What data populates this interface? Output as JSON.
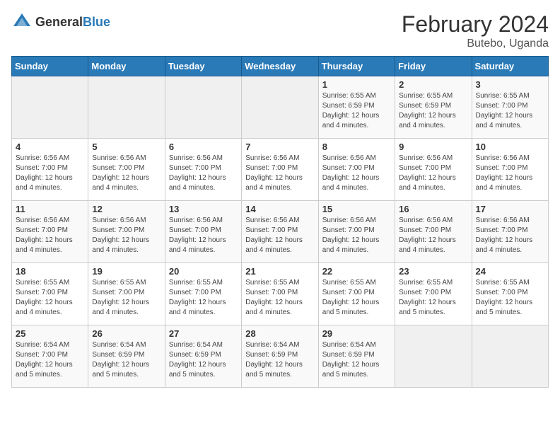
{
  "header": {
    "logo_general": "General",
    "logo_blue": "Blue",
    "month": "February 2024",
    "location": "Butebo, Uganda"
  },
  "days_of_week": [
    "Sunday",
    "Monday",
    "Tuesday",
    "Wednesday",
    "Thursday",
    "Friday",
    "Saturday"
  ],
  "weeks": [
    [
      {
        "day": "",
        "info": "",
        "empty": true
      },
      {
        "day": "",
        "info": "",
        "empty": true
      },
      {
        "day": "",
        "info": "",
        "empty": true
      },
      {
        "day": "",
        "info": "",
        "empty": true
      },
      {
        "day": "1",
        "info": "Sunrise: 6:55 AM\nSunset: 6:59 PM\nDaylight: 12 hours\nand 4 minutes.",
        "empty": false
      },
      {
        "day": "2",
        "info": "Sunrise: 6:55 AM\nSunset: 6:59 PM\nDaylight: 12 hours\nand 4 minutes.",
        "empty": false
      },
      {
        "day": "3",
        "info": "Sunrise: 6:55 AM\nSunset: 7:00 PM\nDaylight: 12 hours\nand 4 minutes.",
        "empty": false
      }
    ],
    [
      {
        "day": "4",
        "info": "Sunrise: 6:56 AM\nSunset: 7:00 PM\nDaylight: 12 hours\nand 4 minutes.",
        "empty": false
      },
      {
        "day": "5",
        "info": "Sunrise: 6:56 AM\nSunset: 7:00 PM\nDaylight: 12 hours\nand 4 minutes.",
        "empty": false
      },
      {
        "day": "6",
        "info": "Sunrise: 6:56 AM\nSunset: 7:00 PM\nDaylight: 12 hours\nand 4 minutes.",
        "empty": false
      },
      {
        "day": "7",
        "info": "Sunrise: 6:56 AM\nSunset: 7:00 PM\nDaylight: 12 hours\nand 4 minutes.",
        "empty": false
      },
      {
        "day": "8",
        "info": "Sunrise: 6:56 AM\nSunset: 7:00 PM\nDaylight: 12 hours\nand 4 minutes.",
        "empty": false
      },
      {
        "day": "9",
        "info": "Sunrise: 6:56 AM\nSunset: 7:00 PM\nDaylight: 12 hours\nand 4 minutes.",
        "empty": false
      },
      {
        "day": "10",
        "info": "Sunrise: 6:56 AM\nSunset: 7:00 PM\nDaylight: 12 hours\nand 4 minutes.",
        "empty": false
      }
    ],
    [
      {
        "day": "11",
        "info": "Sunrise: 6:56 AM\nSunset: 7:00 PM\nDaylight: 12 hours\nand 4 minutes.",
        "empty": false
      },
      {
        "day": "12",
        "info": "Sunrise: 6:56 AM\nSunset: 7:00 PM\nDaylight: 12 hours\nand 4 minutes.",
        "empty": false
      },
      {
        "day": "13",
        "info": "Sunrise: 6:56 AM\nSunset: 7:00 PM\nDaylight: 12 hours\nand 4 minutes.",
        "empty": false
      },
      {
        "day": "14",
        "info": "Sunrise: 6:56 AM\nSunset: 7:00 PM\nDaylight: 12 hours\nand 4 minutes.",
        "empty": false
      },
      {
        "day": "15",
        "info": "Sunrise: 6:56 AM\nSunset: 7:00 PM\nDaylight: 12 hours\nand 4 minutes.",
        "empty": false
      },
      {
        "day": "16",
        "info": "Sunrise: 6:56 AM\nSunset: 7:00 PM\nDaylight: 12 hours\nand 4 minutes.",
        "empty": false
      },
      {
        "day": "17",
        "info": "Sunrise: 6:56 AM\nSunset: 7:00 PM\nDaylight: 12 hours\nand 4 minutes.",
        "empty": false
      }
    ],
    [
      {
        "day": "18",
        "info": "Sunrise: 6:55 AM\nSunset: 7:00 PM\nDaylight: 12 hours\nand 4 minutes.",
        "empty": false
      },
      {
        "day": "19",
        "info": "Sunrise: 6:55 AM\nSunset: 7:00 PM\nDaylight: 12 hours\nand 4 minutes.",
        "empty": false
      },
      {
        "day": "20",
        "info": "Sunrise: 6:55 AM\nSunset: 7:00 PM\nDaylight: 12 hours\nand 4 minutes.",
        "empty": false
      },
      {
        "day": "21",
        "info": "Sunrise: 6:55 AM\nSunset: 7:00 PM\nDaylight: 12 hours\nand 4 minutes.",
        "empty": false
      },
      {
        "day": "22",
        "info": "Sunrise: 6:55 AM\nSunset: 7:00 PM\nDaylight: 12 hours\nand 5 minutes.",
        "empty": false
      },
      {
        "day": "23",
        "info": "Sunrise: 6:55 AM\nSunset: 7:00 PM\nDaylight: 12 hours\nand 5 minutes.",
        "empty": false
      },
      {
        "day": "24",
        "info": "Sunrise: 6:55 AM\nSunset: 7:00 PM\nDaylight: 12 hours\nand 5 minutes.",
        "empty": false
      }
    ],
    [
      {
        "day": "25",
        "info": "Sunrise: 6:54 AM\nSunset: 7:00 PM\nDaylight: 12 hours\nand 5 minutes.",
        "empty": false
      },
      {
        "day": "26",
        "info": "Sunrise: 6:54 AM\nSunset: 6:59 PM\nDaylight: 12 hours\nand 5 minutes.",
        "empty": false
      },
      {
        "day": "27",
        "info": "Sunrise: 6:54 AM\nSunset: 6:59 PM\nDaylight: 12 hours\nand 5 minutes.",
        "empty": false
      },
      {
        "day": "28",
        "info": "Sunrise: 6:54 AM\nSunset: 6:59 PM\nDaylight: 12 hours\nand 5 minutes.",
        "empty": false
      },
      {
        "day": "29",
        "info": "Sunrise: 6:54 AM\nSunset: 6:59 PM\nDaylight: 12 hours\nand 5 minutes.",
        "empty": false
      },
      {
        "day": "",
        "info": "",
        "empty": true
      },
      {
        "day": "",
        "info": "",
        "empty": true
      }
    ]
  ]
}
